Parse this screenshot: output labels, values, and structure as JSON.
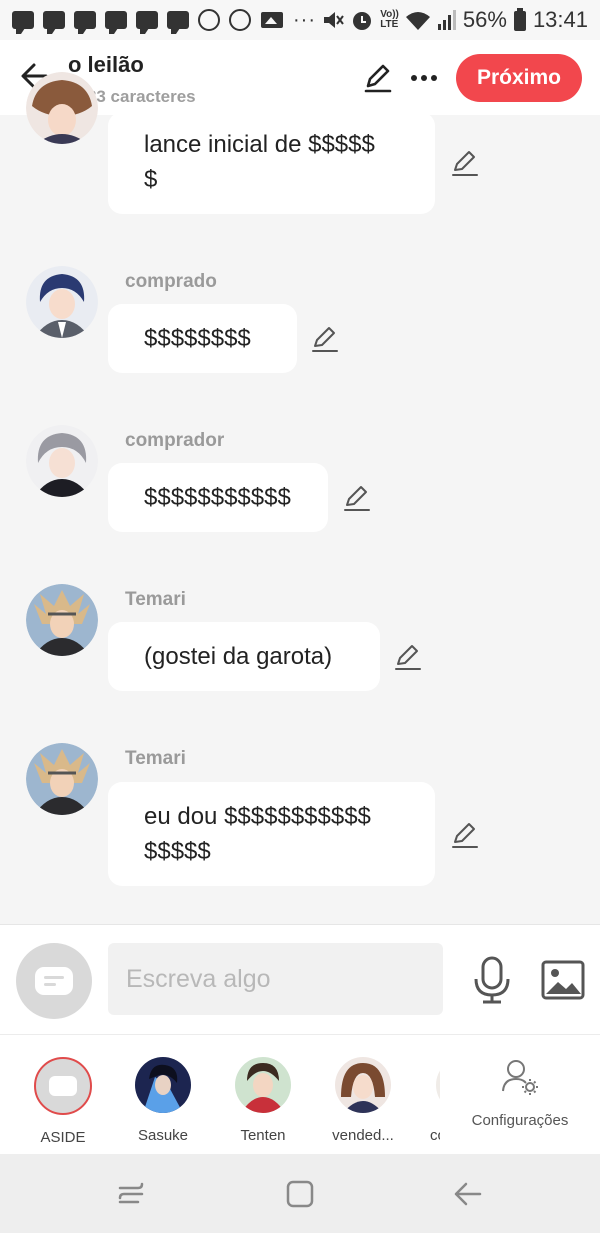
{
  "status_bar": {
    "volte": "Vo))",
    "lte": "LTE",
    "battery": "56%",
    "time": "13:41"
  },
  "header": {
    "title": "o leilão",
    "subtitle": "1583 caracteres",
    "next_label": "Próximo",
    "accent": "#f2474d"
  },
  "messages": [
    {
      "sender": "",
      "text": "lance inicial de $$$$$\n$"
    },
    {
      "sender": "comprado",
      "text": "$$$$$$$$"
    },
    {
      "sender": "comprador",
      "text": "$$$$$$$$$$$"
    },
    {
      "sender": "Temari",
      "text": "(gostei da garota)"
    },
    {
      "sender": "Temari",
      "text": "eu dou $$$$$$$$$$$\n$$$$$"
    }
  ],
  "composer": {
    "placeholder": "Escreva algo"
  },
  "characters": [
    {
      "name": "ASIDE"
    },
    {
      "name": "Sasuke"
    },
    {
      "name": "Tenten"
    },
    {
      "name": "vended..."
    },
    {
      "name": "cc"
    }
  ],
  "settings_label": "Configurações"
}
